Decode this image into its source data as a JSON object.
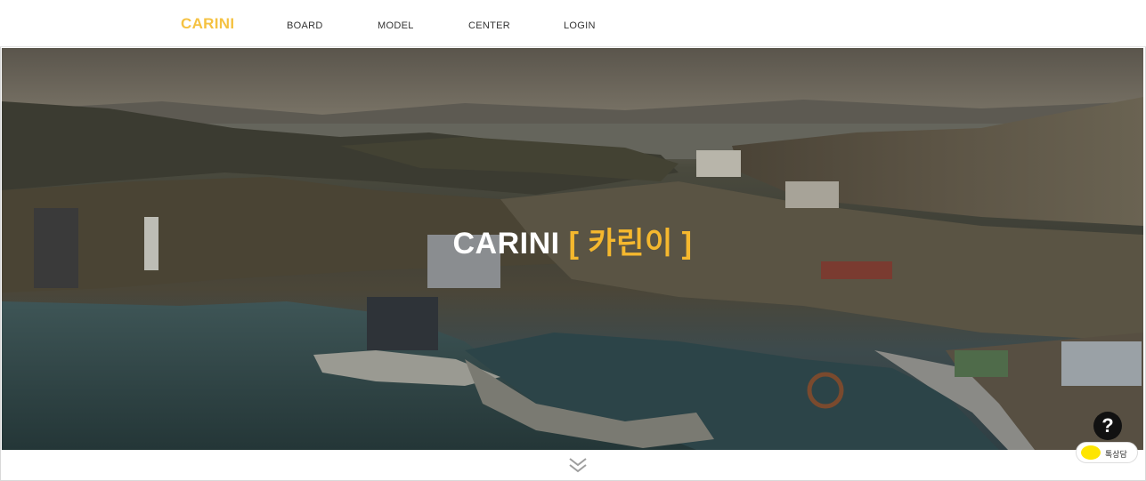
{
  "header": {
    "logo": "CARINI",
    "nav": [
      "BOARD",
      "MODEL",
      "CENTER",
      "LOGIN"
    ]
  },
  "hero": {
    "brand": "CARINI",
    "tag": "[ 카린이 ]"
  },
  "widgets": {
    "help": "?",
    "chat_label": "톡상담"
  },
  "colors": {
    "accent": "#f5c242",
    "hero_tag": "#f5b82e",
    "chat_yellow": "#fee500"
  },
  "icons": {
    "scroll": "double-chevron-down-icon",
    "help": "question-icon",
    "chat": "kakao-chat-icon"
  }
}
